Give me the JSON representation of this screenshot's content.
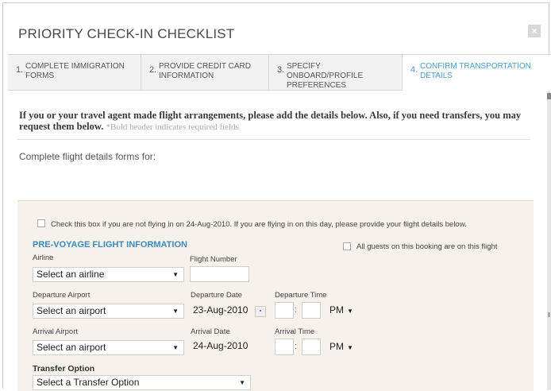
{
  "dialog": {
    "title": "PRIORITY CHECK-IN CHECKLIST",
    "close_glyph": "×"
  },
  "tabs": [
    {
      "num": "1.",
      "label": "COMPLETE IMMIGRATION FORMS"
    },
    {
      "num": "2.",
      "label": "PROVIDE CREDIT CARD INFORMATION"
    },
    {
      "num": "3.",
      "label": "SPECIFY ONBOARD/PROFILE PREFERENCES"
    },
    {
      "num": "4.",
      "label": "CONFIRM TRANSPORTATION DETAILS"
    }
  ],
  "intro": {
    "text": "If you or your travel agent made flight arrangements, please add the details below. Also, if you need transfers, you may request them below.",
    "required_note": "*Bold header indicates required fields"
  },
  "complete_label": "Complete flight details forms for:",
  "not_flying": "Check this box if you are not flying in on 24-Aug-2010. If you are flying in on this day, please provide your flight details below.",
  "section_title": "PRE-VOYAGE FLIGHT INFORMATION",
  "all_guests": "All guests on this booking are on this flight",
  "form": {
    "airline_label": "Airline",
    "airline_value": "Select an airline",
    "flight_number_label": "Flight Number",
    "departure_airport_label": "Departure Airport",
    "departure_airport_value": "Select an airport",
    "departure_date_label": "Departure Date",
    "departure_date_value": "23-Aug-2010",
    "departure_time_label": "Departure Time",
    "departure_ampm": "PM",
    "arrival_airport_label": "Arrival Airport",
    "arrival_airport_value": "Select an airport",
    "arrival_date_label": "Arrival Date",
    "arrival_date_value": "24-Aug-2010",
    "arrival_time_label": "Arrival Time",
    "arrival_ampm": "PM",
    "transfer_label": "Transfer Option",
    "transfer_value": "Select a Transfer Option",
    "time_sep": ":",
    "dropdown_glyph": "▼",
    "cal_glyph": "▪"
  },
  "colors": {
    "accent": "#3d8bbd",
    "panel": "#f7f1eb"
  }
}
